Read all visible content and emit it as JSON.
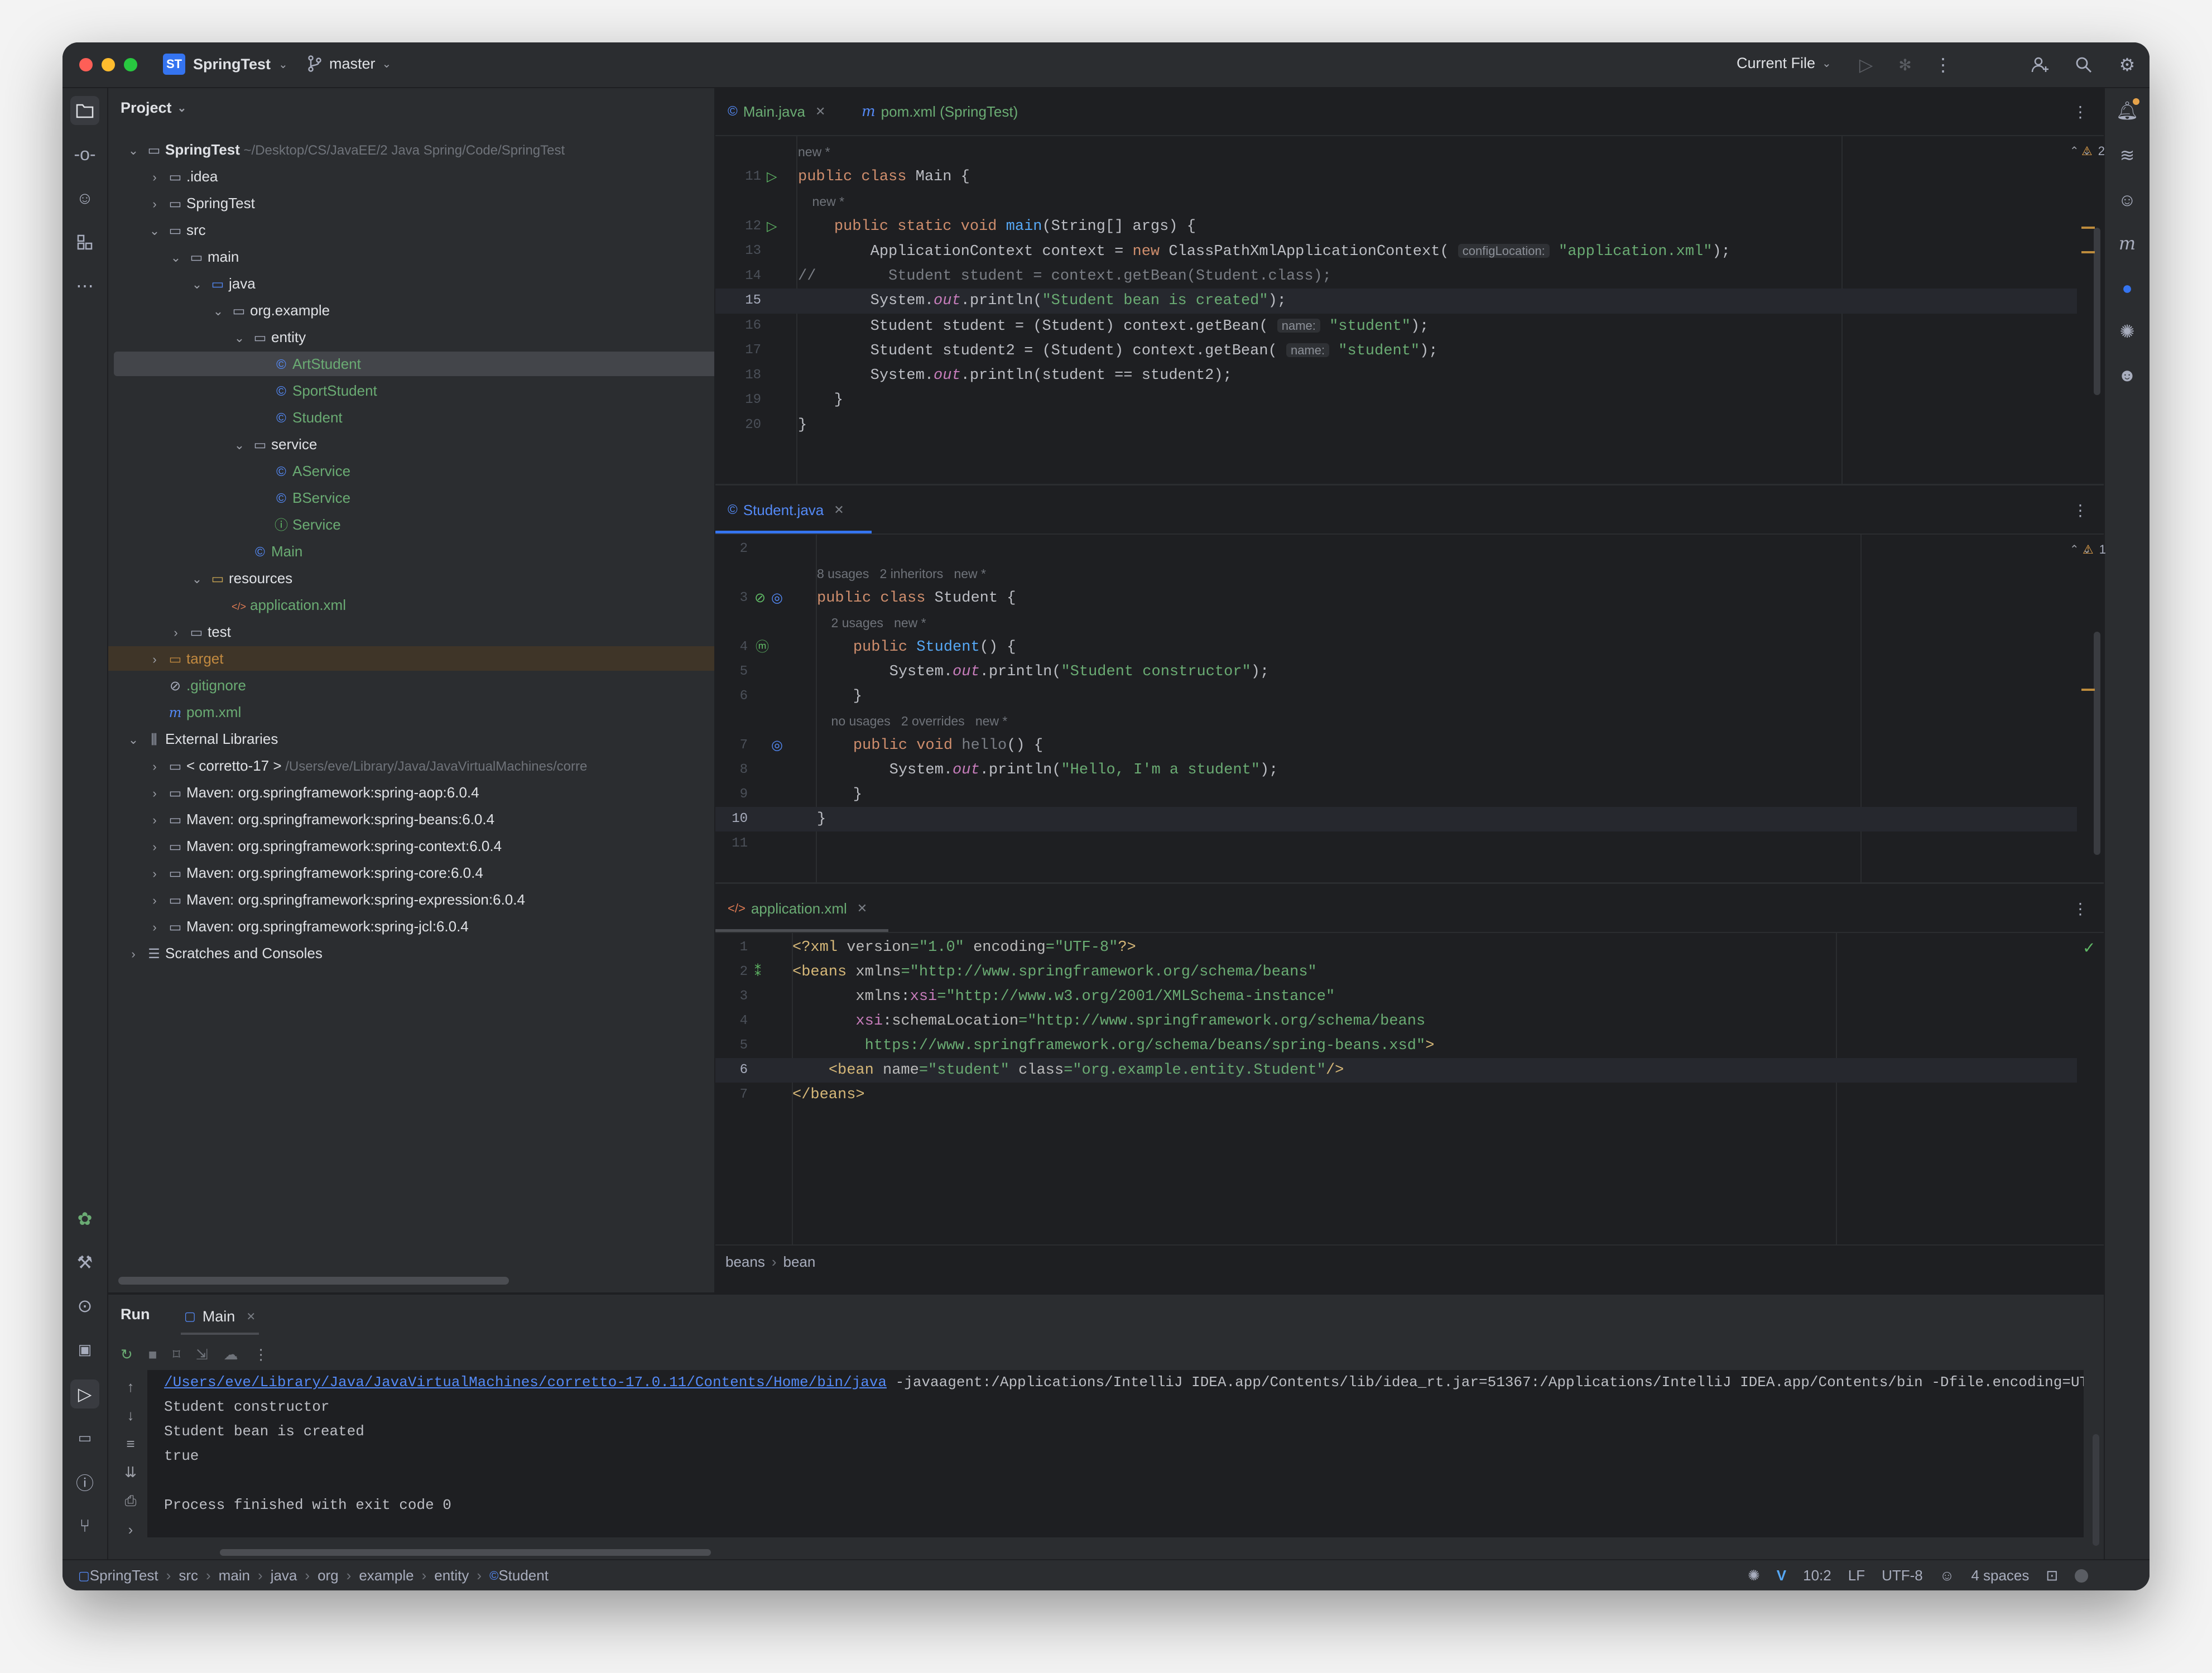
{
  "titlebar": {
    "project_badge": "ST",
    "project_name": "SpringTest",
    "branch": "master",
    "run_config": "Current File"
  },
  "project_panel": {
    "title": "Project",
    "rows": [
      {
        "name": "SpringTest",
        "extra": "~/Desktop/CS/JavaEE/2 Java Spring/Code/SpringTest",
        "depth": 0,
        "arrow": "v",
        "icon": "folder-module",
        "color": "#dfe1e5",
        "bold": true
      },
      {
        "name": ".idea",
        "depth": 1,
        "arrow": ">",
        "icon": "folder",
        "color": "#dfe1e5"
      },
      {
        "name": "SpringTest",
        "depth": 1,
        "arrow": ">",
        "icon": "folder",
        "color": "#dfe1e5"
      },
      {
        "name": "src",
        "depth": 1,
        "arrow": "v",
        "icon": "folder",
        "color": "#dfe1e5"
      },
      {
        "name": "main",
        "depth": 2,
        "arrow": "v",
        "icon": "folder",
        "color": "#dfe1e5"
      },
      {
        "name": "java",
        "depth": 3,
        "arrow": "v",
        "icon": "folder-source",
        "color": "#dfe1e5"
      },
      {
        "name": "org.example",
        "depth": 4,
        "arrow": "v",
        "icon": "package",
        "color": "#dfe1e5"
      },
      {
        "name": "entity",
        "depth": 5,
        "arrow": "v",
        "icon": "package",
        "color": "#dfe1e5"
      },
      {
        "name": "ArtStudent",
        "depth": 6,
        "arrow": "",
        "icon": "class",
        "color": "#6aab73",
        "selected": true
      },
      {
        "name": "SportStudent",
        "depth": 6,
        "arrow": "",
        "icon": "class",
        "color": "#6aab73"
      },
      {
        "name": "Student",
        "depth": 6,
        "arrow": "",
        "icon": "class",
        "color": "#6aab73"
      },
      {
        "name": "service",
        "depth": 5,
        "arrow": "v",
        "icon": "package",
        "color": "#dfe1e5"
      },
      {
        "name": "AService",
        "depth": 6,
        "arrow": "",
        "icon": "class",
        "color": "#6aab73"
      },
      {
        "name": "BService",
        "depth": 6,
        "arrow": "",
        "icon": "class",
        "color": "#6aab73"
      },
      {
        "name": "Service",
        "depth": 6,
        "arrow": "",
        "icon": "interface",
        "color": "#6aab73"
      },
      {
        "name": "Main",
        "depth": 5,
        "arrow": "",
        "icon": "class",
        "color": "#6aab73"
      },
      {
        "name": "resources",
        "depth": 3,
        "arrow": "v",
        "icon": "folder-resources",
        "color": "#dfe1e5"
      },
      {
        "name": "application.xml",
        "depth": 4,
        "arrow": "",
        "icon": "xml",
        "color": "#6aab73"
      },
      {
        "name": "test",
        "depth": 2,
        "arrow": ">",
        "icon": "folder",
        "color": "#dfe1e5"
      },
      {
        "name": "target",
        "depth": 1,
        "arrow": ">",
        "icon": "folder-excluded",
        "color": "#c28a40",
        "target": true
      },
      {
        "name": ".gitignore",
        "depth": 1,
        "arrow": "",
        "icon": "ignore",
        "color": "#6aab73"
      },
      {
        "name": "pom.xml",
        "depth": 1,
        "arrow": "",
        "icon": "maven",
        "color": "#6aab73"
      },
      {
        "name": "External Libraries",
        "depth": 0,
        "arrow": "v",
        "icon": "library",
        "color": "#dfe1e5"
      },
      {
        "name": "< corretto-17 >",
        "extra": "/Users/eve/Library/Java/JavaVirtualMachines/corre",
        "depth": 1,
        "arrow": ">",
        "icon": "folder",
        "color": "#dfe1e5"
      },
      {
        "name": "Maven: org.springframework:spring-aop:6.0.4",
        "depth": 1,
        "arrow": ">",
        "icon": "folder",
        "color": "#dfe1e5"
      },
      {
        "name": "Maven: org.springframework:spring-beans:6.0.4",
        "depth": 1,
        "arrow": ">",
        "icon": "folder",
        "color": "#dfe1e5"
      },
      {
        "name": "Maven: org.springframework:spring-context:6.0.4",
        "depth": 1,
        "arrow": ">",
        "icon": "folder",
        "color": "#dfe1e5"
      },
      {
        "name": "Maven: org.springframework:spring-core:6.0.4",
        "depth": 1,
        "arrow": ">",
        "icon": "folder",
        "color": "#dfe1e5"
      },
      {
        "name": "Maven: org.springframework:spring-expression:6.0.4",
        "depth": 1,
        "arrow": ">",
        "icon": "folder",
        "color": "#dfe1e5"
      },
      {
        "name": "Maven: org.springframework:spring-jcl:6.0.4",
        "depth": 1,
        "arrow": ">",
        "icon": "folder",
        "color": "#dfe1e5"
      },
      {
        "name": "Scratches and Consoles",
        "depth": 0,
        "arrow": ">",
        "icon": "scratches",
        "color": "#dfe1e5"
      }
    ]
  },
  "editor1": {
    "tabs": [
      {
        "label": "Main.java",
        "active": true
      },
      {
        "label": "pom.xml (SpringTest)",
        "active": false
      }
    ],
    "warnings": "2",
    "lines": [
      {
        "num": "",
        "hint": "new *"
      },
      {
        "num": "11",
        "run": true,
        "tokens": [
          [
            "kw",
            "public class "
          ],
          [
            "",
            "Main {"
          ]
        ]
      },
      {
        "num": "",
        "hint": "    new *"
      },
      {
        "num": "12",
        "run": true,
        "tokens": [
          [
            "",
            "    "
          ],
          [
            "kw",
            "public static void "
          ],
          [
            "fn",
            "main"
          ],
          [
            "",
            "(String[] args) {"
          ]
        ]
      },
      {
        "num": "13",
        "tokens": [
          [
            "",
            "        ApplicationContext context = "
          ],
          [
            "kw",
            "new "
          ],
          [
            "",
            "ClassPathXmlApplicationContext( "
          ],
          [
            "inlay",
            "configLocation:"
          ],
          [
            "str",
            " \"application.xml\""
          ],
          [
            "",
            ");"
          ]
        ]
      },
      {
        "num": "14",
        "tokens": [
          [
            "cmt",
            "//        Student student = context.getBean(Student.class);"
          ]
        ]
      },
      {
        "num": "15",
        "current": true,
        "tokens": [
          [
            "",
            "        System."
          ],
          [
            "st",
            "out"
          ],
          [
            "",
            ".println("
          ],
          [
            "str",
            "\"Student bean is created\""
          ],
          [
            "",
            ");"
          ]
        ]
      },
      {
        "num": "16",
        "tokens": [
          [
            "",
            "        Student student = (Student) context.getBean( "
          ],
          [
            "inlay",
            "name:"
          ],
          [
            "str",
            " \"student\""
          ],
          [
            "",
            ");"
          ]
        ]
      },
      {
        "num": "17",
        "tokens": [
          [
            "",
            "        Student student2 = (Student) context.getBean( "
          ],
          [
            "inlay",
            "name:"
          ],
          [
            "str",
            " \"student\""
          ],
          [
            "",
            ");"
          ]
        ]
      },
      {
        "num": "18",
        "tokens": [
          [
            "",
            "        System."
          ],
          [
            "st",
            "out"
          ],
          [
            "",
            ".println(student == student2);"
          ]
        ]
      },
      {
        "num": "19",
        "tokens": [
          [
            "",
            "    }"
          ]
        ]
      },
      {
        "num": "20",
        "tokens": [
          [
            "",
            "}"
          ]
        ]
      }
    ]
  },
  "editor2": {
    "tabs": [
      {
        "label": "Student.java",
        "active": true
      }
    ],
    "warnings": "1",
    "lines": [
      {
        "num": "2",
        "tokens": []
      },
      {
        "num": "",
        "hint": "8 usages   2 inheritors   new *"
      },
      {
        "num": "3",
        "tokens": [
          [
            "kw",
            "public class "
          ],
          [
            "",
            "Student {"
          ]
        ]
      },
      {
        "num": "",
        "hint": "    2 usages   new *"
      },
      {
        "num": "4",
        "tokens": [
          [
            "",
            "    "
          ],
          [
            "kw",
            "public "
          ],
          [
            "fn",
            "Student"
          ],
          [
            "",
            "() {"
          ]
        ]
      },
      {
        "num": "5",
        "tokens": [
          [
            "",
            "        System."
          ],
          [
            "st",
            "out"
          ],
          [
            "",
            ".println("
          ],
          [
            "str",
            "\"Student constructor\""
          ],
          [
            "",
            ");"
          ]
        ]
      },
      {
        "num": "6",
        "tokens": [
          [
            "",
            "    }"
          ]
        ]
      },
      {
        "num": "",
        "hint": "    no usages   2 overrides   new *"
      },
      {
        "num": "7",
        "tokens": [
          [
            "",
            "    "
          ],
          [
            "kw",
            "public void "
          ],
          [
            "cmt",
            "hello"
          ],
          [
            "",
            "() {"
          ]
        ]
      },
      {
        "num": "8",
        "tokens": [
          [
            "",
            "        System."
          ],
          [
            "st",
            "out"
          ],
          [
            "",
            ".println("
          ],
          [
            "str",
            "\"Hello, I'm a student\""
          ],
          [
            "",
            ");"
          ]
        ]
      },
      {
        "num": "9",
        "tokens": [
          [
            "",
            "    }"
          ]
        ]
      },
      {
        "num": "10",
        "current": true,
        "tokens": [
          [
            "",
            "}"
          ]
        ]
      },
      {
        "num": "11",
        "tokens": []
      }
    ]
  },
  "editor3": {
    "tabs": [
      {
        "label": "application.xml",
        "active": true
      }
    ],
    "lines": [
      {
        "num": "1",
        "tokens": [
          [
            "tag",
            "<?xml "
          ],
          [
            "attr",
            "version"
          ],
          [
            "str",
            "=\"1.0\" "
          ],
          [
            "attr",
            "encoding"
          ],
          [
            "str",
            "=\"UTF-8\""
          ],
          [
            "tag",
            "?>"
          ]
        ]
      },
      {
        "num": "2",
        "tokens": [
          [
            "tag",
            "<beans "
          ],
          [
            "attr",
            "xmlns"
          ],
          [
            "str",
            "=\"http://www.springframework.org/schema/beans\""
          ]
        ]
      },
      {
        "num": "3",
        "tokens": [
          [
            "",
            "       "
          ],
          [
            "attr",
            "xmlns"
          ],
          [
            "",
            ":"
          ],
          [
            "ns",
            "xsi"
          ],
          [
            "str",
            "=\"http://www.w3.org/2001/XMLSchema-instance\""
          ]
        ]
      },
      {
        "num": "4",
        "tokens": [
          [
            "",
            "       "
          ],
          [
            "ns",
            "xsi"
          ],
          [
            "",
            ":"
          ],
          [
            "attr",
            "schemaLocation"
          ],
          [
            "str",
            "=\"http://www.springframework.org/schema/beans"
          ]
        ]
      },
      {
        "num": "5",
        "tokens": [
          [
            "str",
            "        https://www.springframework.org/schema/beans/spring-beans.xsd\""
          ],
          [
            "tag",
            ">"
          ]
        ]
      },
      {
        "num": "6",
        "current": true,
        "tokens": [
          [
            "",
            "    "
          ],
          [
            "tag",
            "<bean "
          ],
          [
            "attr",
            "name"
          ],
          [
            "str",
            "=\"student\" "
          ],
          [
            "attr",
            "class"
          ],
          [
            "str",
            "=\"org.example.entity.Student\""
          ],
          [
            "tag",
            "/>"
          ]
        ]
      },
      {
        "num": "7",
        "tokens": [
          [
            "tag",
            "</beans>"
          ]
        ]
      }
    ],
    "breadcrumb": [
      "beans",
      "bean"
    ]
  },
  "run_panel": {
    "title": "Run",
    "tab": "Main",
    "cmd_link": "/Users/eve/Library/Java/JavaVirtualMachines/corretto-17.0.11/Contents/Home/bin/java",
    "cmd_rest": " -javaagent:/Applications/IntelliJ IDEA.app/Contents/lib/idea_rt.jar=51367:/Applications/IntelliJ IDEA.app/Contents/bin -Dfile.encoding=UTF",
    "output": [
      "Student constructor",
      "Student bean is created",
      "true",
      "",
      "Process finished with exit code 0"
    ]
  },
  "statusbar": {
    "crumbs": [
      "SpringTest",
      "src",
      "main",
      "java",
      "org",
      "example",
      "entity",
      "Student"
    ],
    "position": "10:2",
    "line_sep": "LF",
    "encoding": "UTF-8",
    "indent": "4 spaces"
  }
}
